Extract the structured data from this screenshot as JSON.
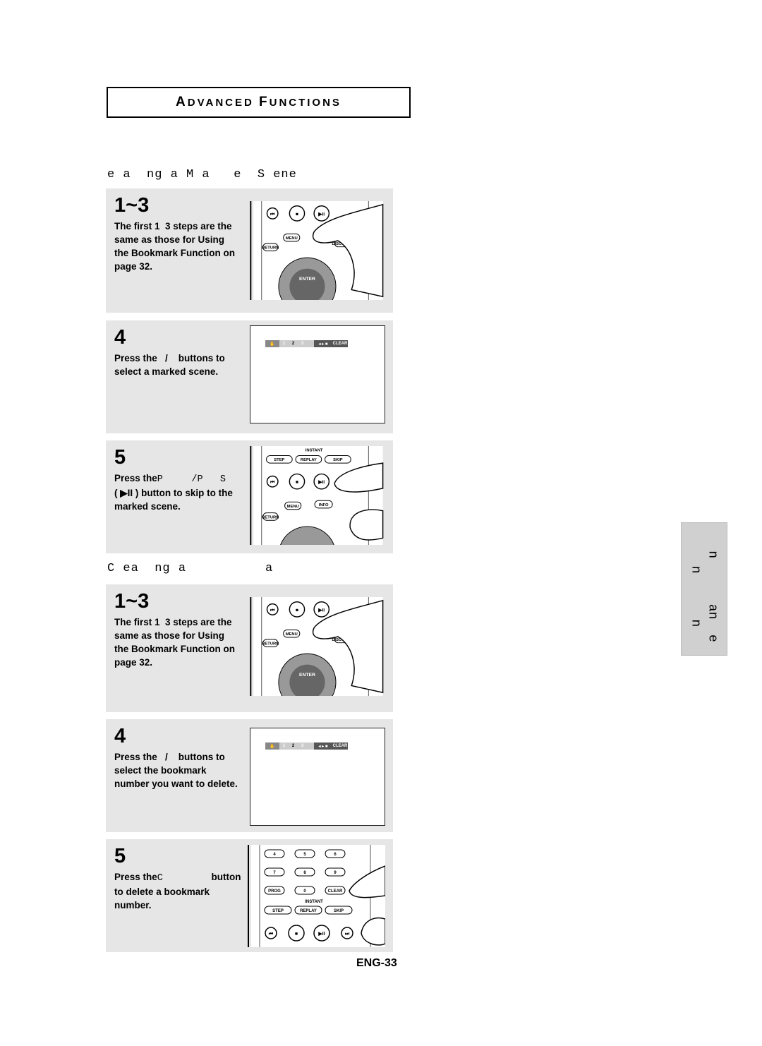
{
  "header": {
    "title_cap1": "A",
    "title_rest1": "DVANCED ",
    "title_cap2": "F",
    "title_rest2": "UNCTIONS"
  },
  "section1": {
    "title": "e a  ng a M a   e  S ene"
  },
  "section2": {
    "title": "C ea  ng a          a"
  },
  "steps1": [
    {
      "num": "1~3",
      "text": "The first 1  3 steps are the same as those for Using the Bookmark Function on page 32."
    },
    {
      "num": "4",
      "text": "Press the   /    buttons to select a marked scene."
    },
    {
      "num": "5",
      "text_a": "Press the",
      "text_mono": "P     /P   S",
      "text_b": "\n( ▶II ) button to skip to the marked scene."
    }
  ],
  "steps2": [
    {
      "num": "1~3",
      "text": "The first 1  3 steps are the same as those for Using the Bookmark Function on page 32."
    },
    {
      "num": "4",
      "text": "Press the   /    buttons to select the bookmark number you want to delete."
    },
    {
      "num": "5",
      "text_a": "Press the",
      "text_mono": "C        ",
      "text_b": " button\nto delete a bookmark number."
    }
  ],
  "osd": {
    "slots": [
      "1",
      "2",
      "3"
    ],
    "clear": "CLEAR"
  },
  "remote": {
    "menu": "MENU",
    "return": "RETURN",
    "disc_menu": "DISC MENU",
    "enter": "ENTER",
    "info": "INFO",
    "instant": "INSTANT",
    "step": "STEP",
    "replay": "REPLAY",
    "skip": "SKIP",
    "prog": "PROG",
    "clear": "CLEAR",
    "keys": [
      "4",
      "5",
      "6",
      "7",
      "8",
      "9",
      "0"
    ]
  },
  "side_tab": {
    "line1": "n      an  e",
    "line2": "n      n"
  },
  "page_number": "ENG-33"
}
